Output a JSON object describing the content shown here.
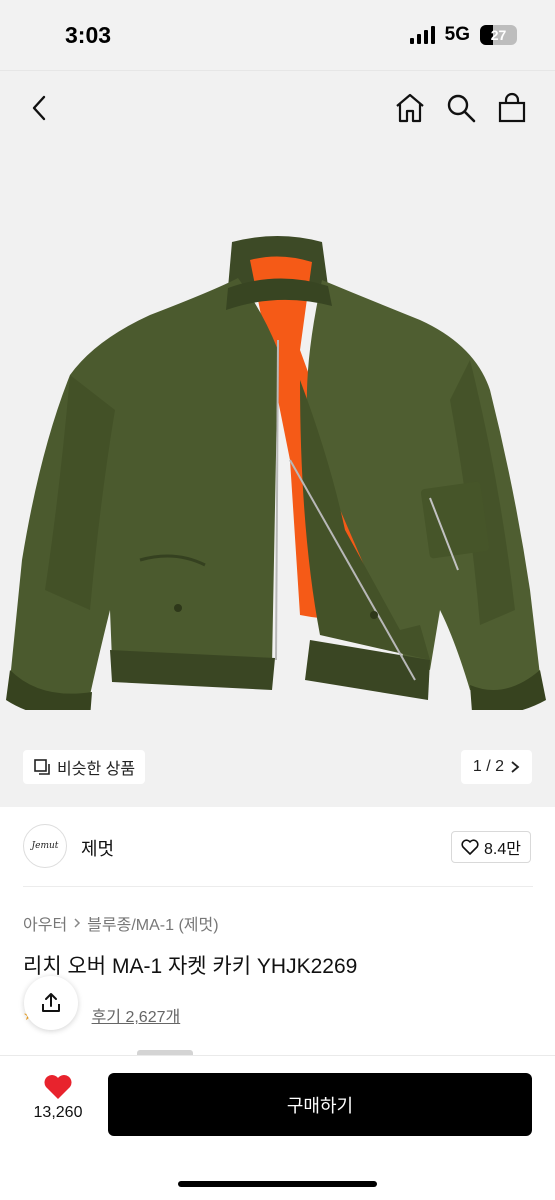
{
  "status": {
    "time": "3:03",
    "network": "5G",
    "battery": "27"
  },
  "nav": {
    "back_icon": "back-arrow-icon",
    "home_icon": "home-icon",
    "search_icon": "search-icon",
    "bag_icon": "shopping-bag-icon"
  },
  "gallery": {
    "similar_label": "비슷한 상품",
    "page_indicator": "1 / 2"
  },
  "brand": {
    "logo_text": "Jemut",
    "name": "제멋",
    "likes": "8.4만"
  },
  "product": {
    "breadcrumb": [
      "아우터",
      "블루종/MA-1 (제멋)"
    ],
    "title": "리치 오버 MA-1 자켓 카키 YHJK2269",
    "review_link": "후기 2,627개"
  },
  "bottom": {
    "wish_count": "13,260",
    "buy_label": "구매하기"
  },
  "colors": {
    "jacket_olive": "#4b5a2e",
    "lining_orange": "#f55a17",
    "buy_button": "#000000",
    "heart": "#e8232d"
  }
}
